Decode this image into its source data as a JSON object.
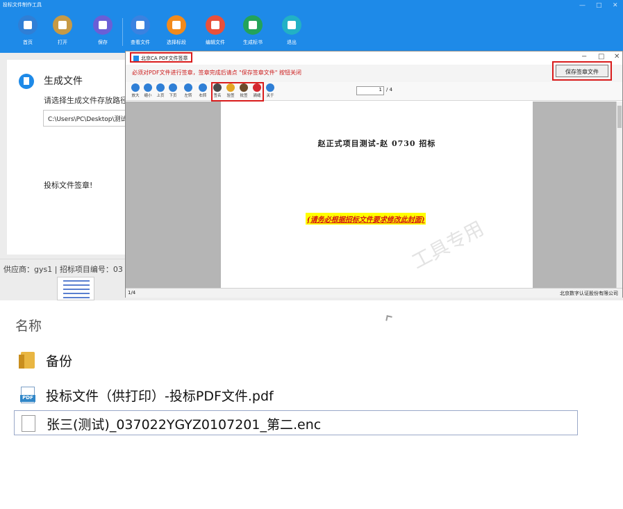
{
  "app": {
    "title": "投标文件制作工具",
    "accent": "#1e8ae8",
    "toolbar": [
      {
        "label": "首页",
        "icon": "home-icon",
        "color": "#2f7fd6"
      },
      {
        "label": "打开",
        "icon": "folder-open-icon",
        "color": "#c79a45"
      },
      {
        "label": "保存",
        "icon": "save-icon",
        "color": "#6a5fd6"
      },
      {
        "label": "查看文件",
        "icon": "view-file-icon",
        "color": "#3b82e0"
      },
      {
        "label": "选择标段",
        "icon": "select-section-icon",
        "color": "#f28a1b"
      },
      {
        "label": "编辑文件",
        "icon": "edit-file-icon",
        "color": "#e9503a"
      },
      {
        "label": "生成标书",
        "icon": "generate-bid-icon",
        "color": "#23a35a"
      },
      {
        "label": "退出",
        "icon": "exit-icon",
        "color": "#22b1c5"
      }
    ],
    "panel": {
      "title": "生成文件",
      "hint": "请选择生成文件存放路径",
      "path": "C:\\Users\\PC\\Desktop\\测试",
      "sign_label": "投标文件签章!"
    },
    "status": {
      "supplier": "供应商：gys1",
      "project": "招标项目编号：03"
    }
  },
  "ca_window": {
    "title": "北京CA  PDF文件签章",
    "controls": [
      "−",
      "□",
      "✕"
    ],
    "notice": "必须对PDF文件进行签章，签章完成后请点  \"保存签章文件\"  按钮关闭",
    "save_button": "保存签章文件",
    "tools": [
      {
        "label": "放大",
        "icon": "zoom-in-icon",
        "color": "#2f7fd6"
      },
      {
        "label": "缩小",
        "icon": "zoom-out-icon",
        "color": "#2f7fd6"
      },
      {
        "label": "上页",
        "icon": "page-up-icon",
        "color": "#2f7fd6"
      },
      {
        "label": "下页",
        "icon": "page-down-icon",
        "color": "#2f7fd6"
      },
      {
        "label": "左转",
        "icon": "rotate-left-icon",
        "color": "#2f7fd6"
      },
      {
        "label": "右转",
        "icon": "rotate-right-icon",
        "color": "#2f7fd6"
      },
      {
        "label": "签名",
        "icon": "sign-icon",
        "color": "#4a4a4a"
      },
      {
        "label": "验签",
        "icon": "verify-icon",
        "color": "#e3a623"
      },
      {
        "label": "批签",
        "icon": "batch-sign-icon",
        "color": "#6b4a2a"
      },
      {
        "label": "骑缝",
        "icon": "seam-seal-icon",
        "color": "#d3262f"
      },
      {
        "label": "关于",
        "icon": "info-icon",
        "color": "#2f7fd6"
      }
    ],
    "page_current": "1",
    "page_total": "/ 4",
    "document": {
      "heading": "赵正式项目测试-赵 0730 招标",
      "note": "(请务必根据招标文件要求修改此封面)",
      "watermark": "工具专用"
    },
    "status_page": "1/4",
    "company": "北京数字认证股份有限公司"
  },
  "explorer": {
    "column_header": "名称",
    "files": [
      {
        "name": "备份",
        "icon": "folder-icon"
      },
      {
        "name": "投标文件（供打印）-投标PDF文件.pdf",
        "icon": "pdf-file-icon"
      },
      {
        "name": "张三(测试)_037022YGYZ0107201_第二.enc",
        "icon": "enc-file-icon"
      }
    ]
  }
}
